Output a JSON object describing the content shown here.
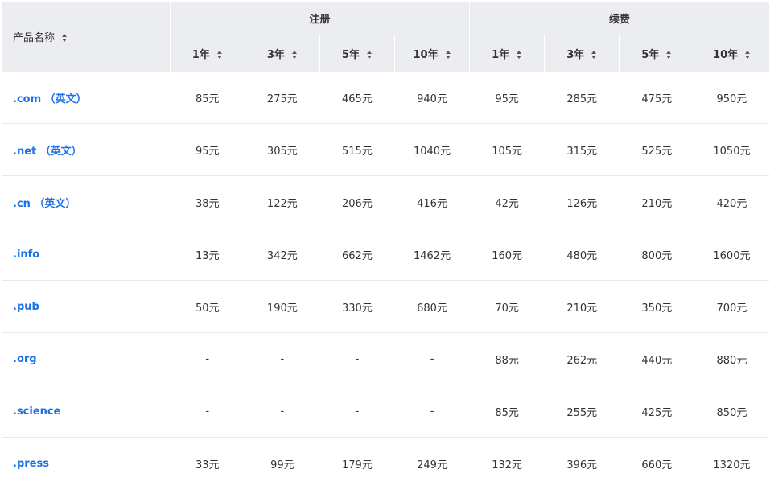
{
  "header": {
    "product_name": "产品名称",
    "groups": [
      {
        "label": "注册",
        "years": [
          "1年",
          "3年",
          "5年",
          "10年"
        ]
      },
      {
        "label": "续费",
        "years": [
          "1年",
          "3年",
          "5年",
          "10年"
        ]
      }
    ]
  },
  "rows": [
    {
      "name": ".com （英文）",
      "register": [
        "85元",
        "275元",
        "465元",
        "940元"
      ],
      "renew": [
        "95元",
        "285元",
        "475元",
        "950元"
      ]
    },
    {
      "name": ".net （英文）",
      "register": [
        "95元",
        "305元",
        "515元",
        "1040元"
      ],
      "renew": [
        "105元",
        "315元",
        "525元",
        "1050元"
      ]
    },
    {
      "name": ".cn （英文）",
      "register": [
        "38元",
        "122元",
        "206元",
        "416元"
      ],
      "renew": [
        "42元",
        "126元",
        "210元",
        "420元"
      ]
    },
    {
      "name": ".info",
      "register": [
        "13元",
        "342元",
        "662元",
        "1462元"
      ],
      "renew": [
        "160元",
        "480元",
        "800元",
        "1600元"
      ]
    },
    {
      "name": ".pub",
      "register": [
        "50元",
        "190元",
        "330元",
        "680元"
      ],
      "renew": [
        "70元",
        "210元",
        "350元",
        "700元"
      ]
    },
    {
      "name": ".org",
      "register": [
        "-",
        "-",
        "-",
        "-"
      ],
      "renew": [
        "88元",
        "262元",
        "440元",
        "880元"
      ]
    },
    {
      "name": ".science",
      "register": [
        "-",
        "-",
        "-",
        "-"
      ],
      "renew": [
        "85元",
        "255元",
        "425元",
        "850元"
      ]
    },
    {
      "name": ".press",
      "register": [
        "33元",
        "99元",
        "179元",
        "249元"
      ],
      "renew": [
        "132元",
        "396元",
        "660元",
        "1320元"
      ]
    }
  ],
  "colors": {
    "header_bg": "#ebedf1",
    "link": "#1a73e8",
    "text": "#333333",
    "row_divider": "#e8e8e8"
  },
  "icons": {
    "sort": "sort-icon"
  }
}
